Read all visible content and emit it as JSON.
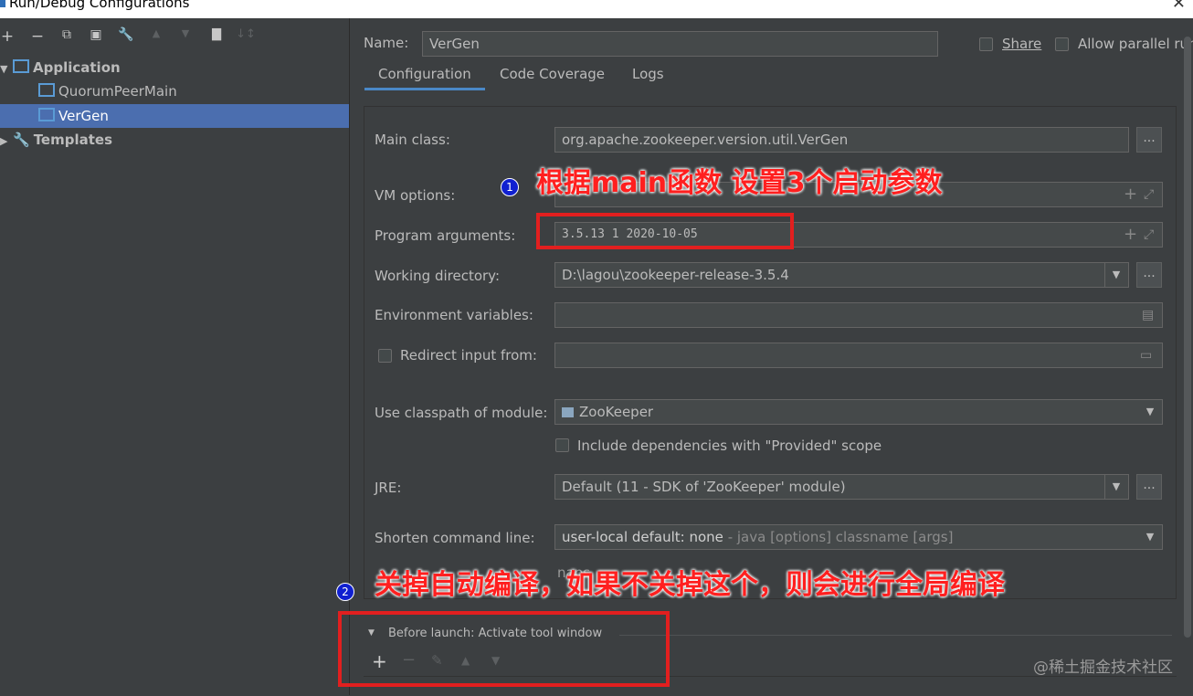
{
  "window": {
    "title": "Run/Debug Configurations",
    "close": "✕"
  },
  "toolbar": {
    "add": "+",
    "remove": "−",
    "copy": "⧉",
    "save": "▣",
    "edit": "🔧",
    "up": "▲",
    "down": "▼",
    "folder": "▇",
    "sort": "↓↕"
  },
  "tree": {
    "application": "Application",
    "quorum": "QuorumPeerMain",
    "vergen": "VerGen",
    "templates": "Templates"
  },
  "header": {
    "name_label": "Name:",
    "name_value": "VerGen",
    "share": "Share",
    "allow_parallel": "Allow parallel run"
  },
  "tabs": [
    "Configuration",
    "Code Coverage",
    "Logs"
  ],
  "form": {
    "main_class_label": "Main class:",
    "main_class_value": "org.apache.zookeeper.version.util.VerGen",
    "vm_options_label": "VM options:",
    "vm_options_value": "",
    "program_args_label": "Program arguments:",
    "program_args_value": "3.5.13 1 2020-10-05",
    "working_dir_label": "Working directory:",
    "working_dir_value": "D:\\lagou\\zookeeper-release-3.5.4",
    "env_vars_label": "Environment variables:",
    "redirect_label": "Redirect input from:",
    "classpath_label": "Use classpath of module:",
    "classpath_value": "ZooKeeper",
    "include_deps": "Include dependencies with \"Provided\" scope",
    "jre_label": "JRE:",
    "jre_value": "Default (11 - SDK of 'ZooKeeper' module)",
    "shorten_label": "Shorten command line:",
    "shorten_value": "user-local default: none",
    "shorten_hint": " - java [options] classname [args]",
    "snapshot_partial": "naps"
  },
  "before_launch": {
    "title": "Before launch: Activate tool window",
    "add": "+",
    "remove": "−",
    "edit": "✎",
    "up": "▲",
    "down": "▼"
  },
  "annotations": {
    "note1_num": "1",
    "note1": "根据main函数 设置3个启动参数",
    "note2_num": "2",
    "note2": "关掉自动编译，如果不关掉这个，则会进行全局编译"
  },
  "watermark": "@稀土掘金技术社区",
  "colors": {
    "accent": "#4a88c7",
    "selection": "#4b6eaf",
    "annotation": "#e21f1f"
  }
}
